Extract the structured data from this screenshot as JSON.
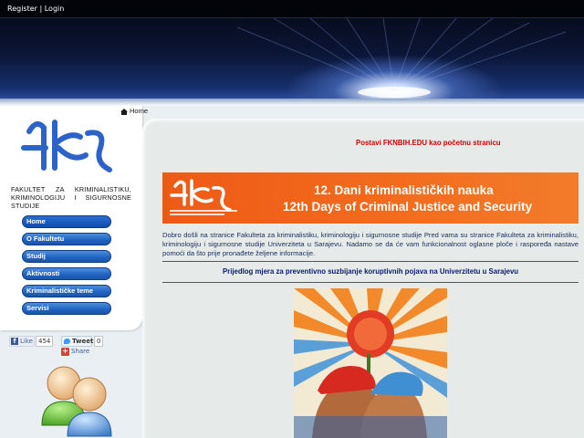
{
  "topbar": {
    "register": "Register",
    "separator": "|",
    "login": "Login"
  },
  "sidebar": {
    "logo_text": "FAKULTET ZA KRIMINALISTIKU, KRIMINOLOGIJU I SIGURNOSNE STUDIJE",
    "nav": [
      {
        "label": "Home",
        "active": true
      },
      {
        "label": "O Fakultetu"
      },
      {
        "label": "Studij"
      },
      {
        "label": "Aktivnosti"
      },
      {
        "label": "Kriminalističke teme"
      },
      {
        "label": "Servisi"
      }
    ],
    "social": {
      "like_label": "Like",
      "like_count": "454",
      "tweet_label": "Tweet",
      "tweet_count": "0",
      "share_label": "Share"
    }
  },
  "breadcrumb": {
    "label": "Home"
  },
  "main": {
    "homepage_link": "Postavi FKNBIH.EDU kao početnu stranicu",
    "banner_line1": "12. Dani kriminalističkih nauka",
    "banner_line2": "12th Days of Criminal Justice and Security",
    "intro": "Dobro došli na stranice Fakulteta za kriminalistiku, kriminologiju i sigurnosne studije Pred vama su stranice Fakulteta za kriminalistiku, kriminologiju i sigurnosne studije Univerziteta u Sarajevu. Nadamo se da će vam funkcionalnost oglasne ploče i raspoređa nastave pomoći da što prije pronađete željene informacije.",
    "proposal": "Prijedlog mjera za preventivno suzbijanje koruptivnih pojava na Univerzitetu u Sarajevu"
  },
  "colors": {
    "nav_blue": "#1f62c0",
    "link_red": "#cc0000",
    "banner_orange": "#ee5a15",
    "proposal_navy": "#0a1a6a"
  }
}
